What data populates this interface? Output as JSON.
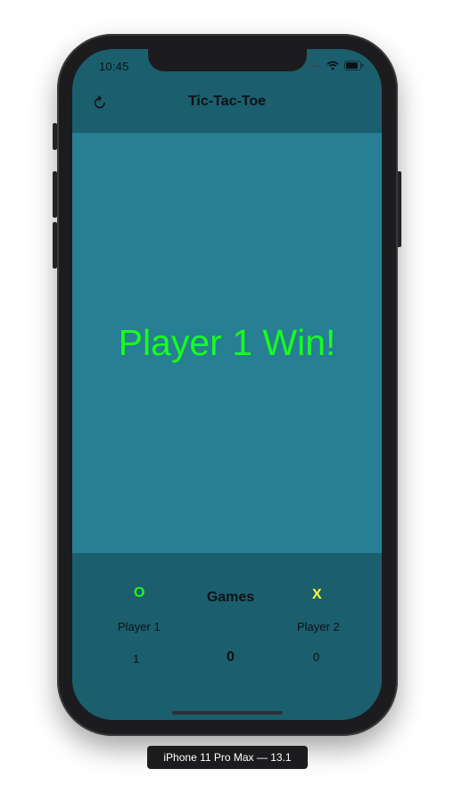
{
  "status_bar": {
    "time": "10:45",
    "icons": [
      "signal-icon",
      "wifi-icon",
      "battery-icon"
    ]
  },
  "nav": {
    "title": "Tic-Tac-Toe",
    "reload_icon": "reload-icon"
  },
  "board": {
    "message": "Player 1 Win!"
  },
  "scoreboard": {
    "player1": {
      "mark": "O",
      "name": "Player 1",
      "score": "1"
    },
    "games": {
      "label": "Games",
      "draws": "0"
    },
    "player2": {
      "mark": "X",
      "name": "Player 2",
      "score": "0"
    }
  },
  "device": {
    "label": "iPhone 11 Pro Max — 13.1"
  },
  "colors": {
    "header_bg": "#1b5f6e",
    "board_bg": "#267f93",
    "player1": "#18ff1b",
    "player2": "#ffff2a"
  }
}
